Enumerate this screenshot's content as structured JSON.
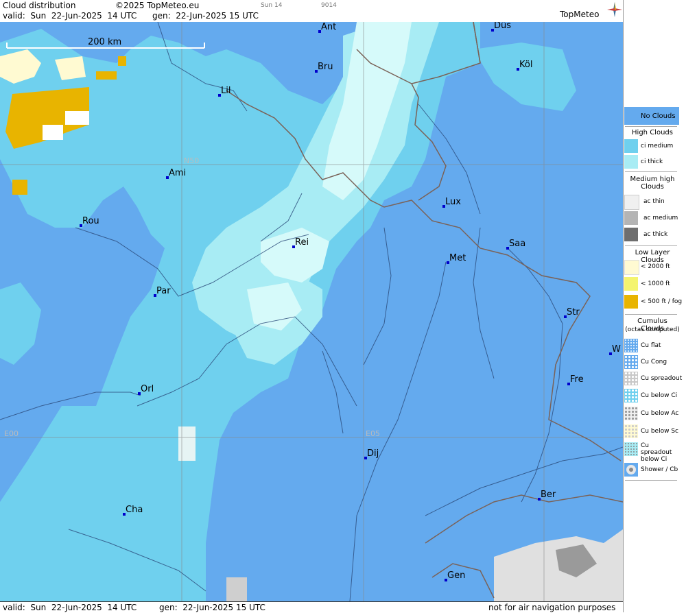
{
  "header": {
    "title": "Cloud distribution",
    "copyright": "©2025 TopMeteo.eu",
    "valid": "valid:  Sun  22-Jun-2025  14 UTC",
    "gen": "gen:  22-Jun-2025 15 UTC",
    "small1": "Sun 14",
    "small2": "9014",
    "logo": "TopMeteo"
  },
  "footer": {
    "valid": "valid:  Sun  22-Jun-2025  14 UTC",
    "gen": "gen:  22-Jun-2025 15 UTC",
    "disclaimer": "not for air navigation purposes"
  },
  "map": {
    "scale_label": "200 km",
    "grid_labels": {
      "n50": "N50",
      "e00": "E00",
      "e05": "E05"
    },
    "cities": [
      "Ant",
      "Düs",
      "Bru",
      "Köl",
      "Lil",
      "Ami",
      "Lux",
      "Rou",
      "Rei",
      "Saa",
      "Met",
      "Par",
      "Str",
      "W",
      "Fre",
      "Orl",
      "Dij",
      "Ber",
      "Cha",
      "Gen"
    ]
  },
  "colors": {
    "no_clouds": "#64aaee",
    "ci_medium": "#6fd0ee",
    "ci_thick": "#a8ecf4",
    "ci_very": "#d6fafa",
    "low_2000": "#fffad2",
    "low_1000": "#f4f46e",
    "low_500": "#e8b400",
    "rivers": "#2a4a7a",
    "borders": "#7a6258"
  },
  "legend": {
    "no_clouds": "No Clouds",
    "high_clouds": "High Clouds",
    "ci_medium": "ci medium",
    "ci_thick": "ci thick",
    "medium_high": "Medium high Clouds",
    "ac_thin": "ac thin",
    "ac_medium": "ac medium",
    "ac_thick": "ac thick",
    "low_layer": "Low Layer Clouds",
    "lt2000": "< 2000 ft",
    "lt1000": "< 1000 ft",
    "lt500": "< 500 ft / fog",
    "cumulus": "Cumulus Clouds",
    "octas": "(octas computed)",
    "cu_flat": "Cu flat",
    "cu_cong": "Cu Cong",
    "cu_spreadout": "Cu spreadout",
    "cu_below_ci": "Cu below Ci",
    "cu_below_ac": "Cu below Ac",
    "cu_below_sc": "Cu below Sc",
    "cu_spreadout_ci": "Cu spreadout below Ci",
    "shower": "Shower / Cb"
  }
}
